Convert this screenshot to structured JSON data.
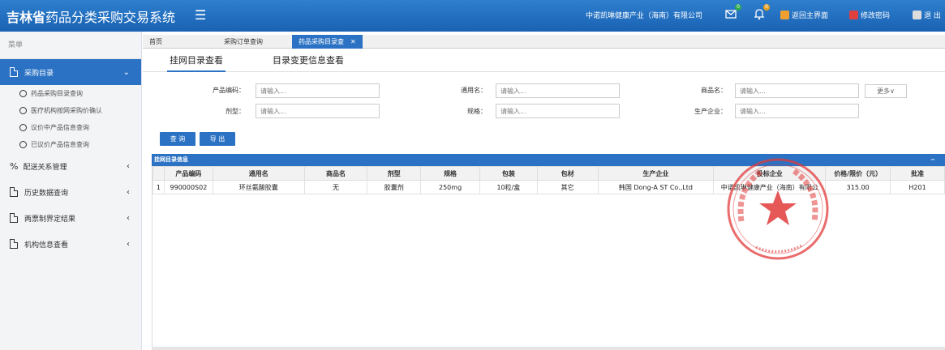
{
  "header": {
    "brand_bold": "吉林省",
    "brand_rest": "药品分类采购交易系统",
    "menu_icon": "☰",
    "company": "中诺凯琳健康产业（海南）有限公司",
    "mail_badge": "0",
    "bell_badge": "0",
    "home_label": "返回主界面",
    "password_label": "修改密码",
    "logout_label": "退 出"
  },
  "sidebar": {
    "title": "菜单",
    "active_section": "采购目录",
    "sub_items": [
      "药品采购目录查询",
      "医疗机构按网采购价确认",
      "议价中产品信息查询",
      "已议价产品信息查询"
    ],
    "sections": [
      "配送关系管理",
      "历史数据查询",
      "两票制界定结果",
      "机构信息查看"
    ]
  },
  "tabs": [
    "首页",
    "采购订单查询",
    "药品采购目录査"
  ],
  "subtabs": [
    "挂网目录查看",
    "目录变更信息查看"
  ],
  "form": {
    "fields": [
      {
        "label": "产品编码：",
        "placeholder": "请输入..."
      },
      {
        "label": "通用名：",
        "placeholder": "请输入..."
      },
      {
        "label": "商品名：",
        "placeholder": "请输入..."
      },
      {
        "label": "剂型：",
        "placeholder": "请输入..."
      },
      {
        "label": "规格：",
        "placeholder": "请输入..."
      },
      {
        "label": "生产企业：",
        "placeholder": "请输入..."
      }
    ],
    "more_label": "更多∨",
    "query_label": "查 询",
    "export_label": "导 出"
  },
  "grid": {
    "title": "挂网目录信息",
    "collapse": "−",
    "columns": [
      "",
      "产品编码",
      "通用名",
      "商品名",
      "剂型",
      "规格",
      "包装",
      "包材",
      "生产企业",
      "投标企业",
      "价格/限价（元）",
      "批准"
    ],
    "rows": [
      [
        "1",
        "990000S02",
        "环丝氨酸胶囊",
        "无",
        "胶囊剂",
        "250mg",
        "10粒/盒",
        "其它",
        "韩国 Dong-A ST Co.,Ltd",
        "中诺凯琳健康产业（海南）有限公",
        "315.00",
        "H201"
      ]
    ]
  },
  "colors": {
    "header": "#1a62b3",
    "accent": "#2b72c4",
    "stamp": "#e23b3b"
  }
}
